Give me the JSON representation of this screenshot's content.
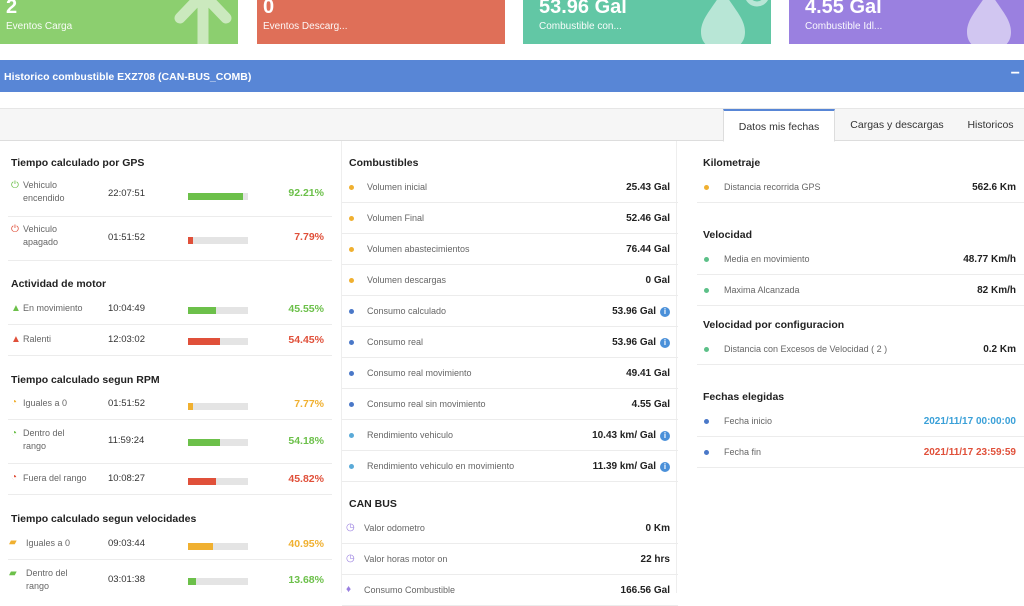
{
  "cards": [
    {
      "num": "2",
      "label": "Eventos Carga",
      "color": "#8ccf6f"
    },
    {
      "num": "0",
      "label": "Eventos Descarg...",
      "color": "#df6f58"
    },
    {
      "num": "53.96 Gal",
      "label": "Combustible con...",
      "color": "#62c7a5"
    },
    {
      "num": "4.55 Gal",
      "label": "Combustible Idl...",
      "color": "#9a80e0"
    }
  ],
  "panel": {
    "title": "Historico combustible EXZ708 (CAN-BUS_COMB)",
    "minimize": "−"
  },
  "tabs": [
    "Datos mis fechas",
    "Cargas y descargas",
    "Historicos"
  ],
  "colA": {
    "gps": {
      "title": "Tiempo calculado por GPS",
      "rows": [
        {
          "l1": "Vehiculo",
          "l2": "encendido",
          "time": "22:07:51",
          "pct": "92.21%",
          "frac": 0.92,
          "color": "#6cc04a"
        },
        {
          "l1": "Vehiculo",
          "l2": "apagado",
          "time": "01:51:52",
          "pct": "7.79%",
          "frac": 0.08,
          "color": "#e0503a"
        }
      ]
    },
    "motor": {
      "title": "Actividad de motor",
      "rows": [
        {
          "l1": "En movimiento",
          "time": "10:04:49",
          "pct": "45.55%",
          "frac": 0.46,
          "color": "#6cc04a"
        },
        {
          "l1": "Ralenti",
          "time": "12:03:02",
          "pct": "54.45%",
          "frac": 0.54,
          "color": "#e0503a"
        }
      ]
    },
    "rpm": {
      "title": "Tiempo calculado segun RPM",
      "rows": [
        {
          "l1": "Iguales a 0",
          "time": "01:51:52",
          "pct": "7.77%",
          "frac": 0.08,
          "color": "#f0b030"
        },
        {
          "l1": "Dentro del",
          "l2": "rango",
          "time": "11:59:24",
          "pct": "54.18%",
          "frac": 0.54,
          "color": "#6cc04a"
        },
        {
          "l1": "Fuera del rango",
          "time": "10:08:27",
          "pct": "45.82%",
          "frac": 0.46,
          "color": "#e0503a"
        }
      ]
    },
    "vel": {
      "title": "Tiempo calculado segun velocidades",
      "rows": [
        {
          "l1": "Iguales a 0",
          "time": "09:03:44",
          "pct": "40.95%",
          "frac": 0.41,
          "color": "#f0b030"
        },
        {
          "l1": "Dentro del",
          "l2": "rango",
          "time": "03:01:38",
          "pct": "13.68%",
          "frac": 0.14,
          "color": "#6cc04a"
        }
      ]
    }
  },
  "colB": {
    "comb": {
      "title": "Combustibles",
      "rows": [
        {
          "label": "Volumen inicial",
          "value": "25.43 Gal",
          "dot": "#f0b030"
        },
        {
          "label": "Volumen Final",
          "value": "52.46 Gal",
          "dot": "#f0b030"
        },
        {
          "label": "Volumen abastecimientos",
          "value": "76.44 Gal",
          "dot": "#f0b030"
        },
        {
          "label": "Volumen descargas",
          "value": "0 Gal",
          "dot": "#f0b030"
        },
        {
          "label": "Consumo calculado",
          "value": "53.96 Gal",
          "dot": "#4a78c8",
          "info": true
        },
        {
          "label": "Consumo real",
          "value": "53.96 Gal",
          "dot": "#4a78c8",
          "info": true
        },
        {
          "label": "Consumo real movimiento",
          "value": "49.41 Gal",
          "dot": "#4a78c8"
        },
        {
          "label": "Consumo real sin movimiento",
          "value": "4.55 Gal",
          "dot": "#4a78c8"
        },
        {
          "label": "Rendimiento vehiculo",
          "value": "10.43 km/ Gal",
          "dot": "#5aaad8",
          "info": true
        },
        {
          "label": "Rendimiento vehiculo en movimiento",
          "value": "11.39 km/ Gal",
          "dot": "#5aaad8",
          "info": true
        }
      ]
    },
    "can": {
      "title": "CAN BUS",
      "rows": [
        {
          "label": "Valor odometro",
          "value": "0 Km",
          "icon": "◷"
        },
        {
          "label": "Valor horas motor on",
          "value": "22 hrs",
          "icon": "◷"
        },
        {
          "label": "Consumo Combustible",
          "value": "166.56 Gal",
          "icon": "♦"
        }
      ]
    }
  },
  "colC": {
    "km": {
      "title": "Kilometraje",
      "rows": [
        {
          "label": "Distancia recorrida GPS",
          "value": "562.6 Km",
          "dot": "#f0b030"
        }
      ]
    },
    "vel": {
      "title": "Velocidad",
      "rows": [
        {
          "label": "Media en movimiento",
          "value": "48.77 Km/h",
          "dot": "#5cc088"
        },
        {
          "label": "Maxima Alcanzada",
          "value": "82 Km/h",
          "dot": "#5cc088"
        }
      ]
    },
    "velc": {
      "title": "Velocidad por configuracion",
      "rows": [
        {
          "label": "Distancia con Excesos de Velocidad ( 2 )",
          "value": "0.2 Km",
          "dot": "#5cc088"
        }
      ]
    },
    "fechas": {
      "title": "Fechas elegidas",
      "rows": [
        {
          "label": "Fecha inicio",
          "value": "2021/11/17 00:00:00",
          "dot": "#4a78c8",
          "color": "#3aa0d8"
        },
        {
          "label": "Fecha fin",
          "value": "2021/11/17 23:59:59",
          "dot": "#4a78c8",
          "color": "#e0503a"
        }
      ]
    }
  }
}
